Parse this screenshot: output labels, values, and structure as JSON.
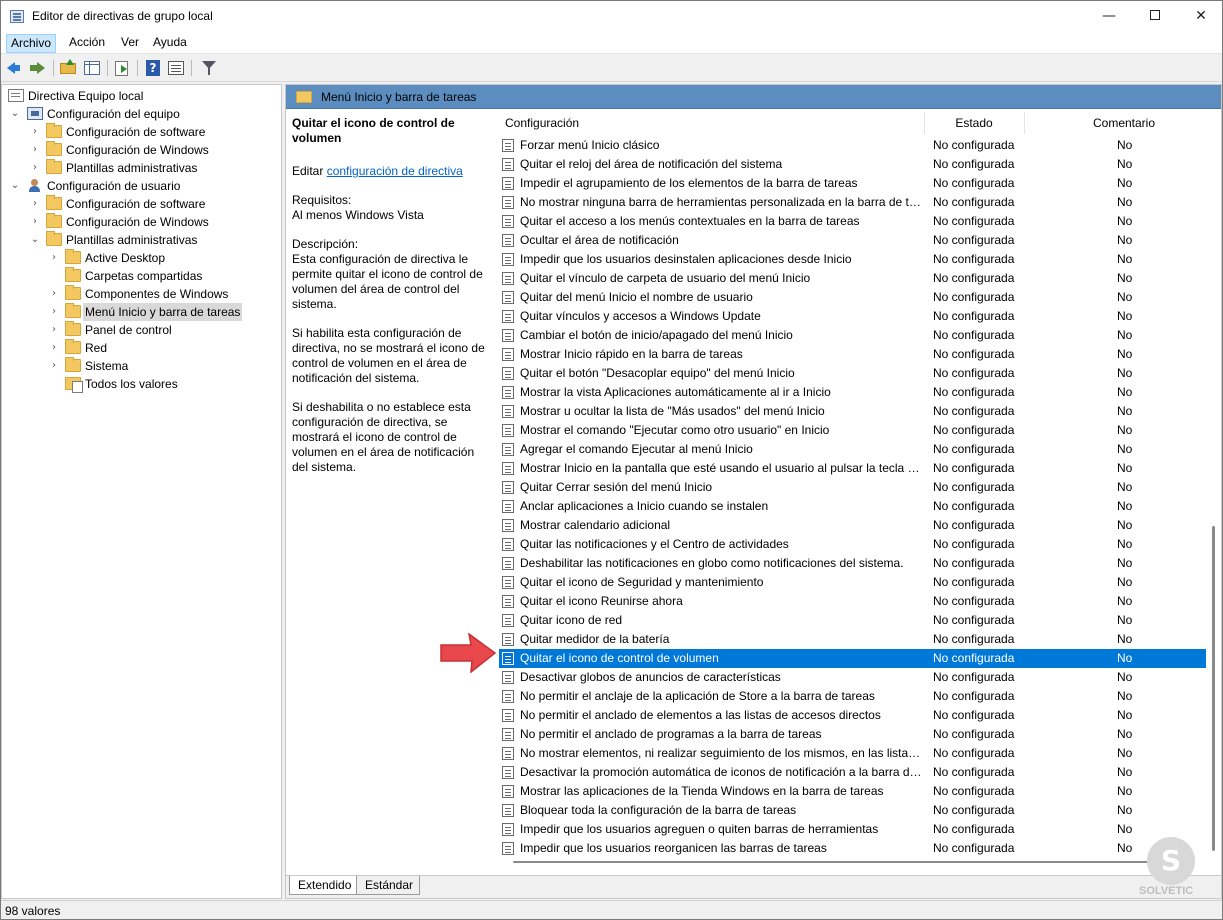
{
  "window": {
    "title": "Editor de directivas de grupo local",
    "minimize_glyph": "—",
    "close_glyph": "✕"
  },
  "menu": {
    "items": [
      "Archivo",
      "Acción",
      "Ver",
      "Ayuda"
    ]
  },
  "tree": {
    "root": "Directiva Equipo local",
    "items": [
      {
        "label": "Configuración del equipo"
      },
      {
        "label": "Configuración de software"
      },
      {
        "label": "Configuración de Windows"
      },
      {
        "label": "Plantillas administrativas"
      },
      {
        "label": "Configuración de usuario"
      },
      {
        "label": "Configuración de software"
      },
      {
        "label": "Configuración de Windows"
      },
      {
        "label": "Plantillas administrativas"
      },
      {
        "label": "Active Desktop"
      },
      {
        "label": "Carpetas compartidas"
      },
      {
        "label": "Componentes de Windows"
      },
      {
        "label": "Menú Inicio y barra de tareas"
      },
      {
        "label": "Panel de control"
      },
      {
        "label": "Red"
      },
      {
        "label": "Sistema"
      },
      {
        "label": "Todos los valores"
      }
    ]
  },
  "main": {
    "header_title": "Menú Inicio y barra de tareas",
    "description": {
      "title": "Quitar el icono de control de volumen",
      "edit_prefix": "Editar",
      "edit_link": "configuración de directiva",
      "requirements_label": "Requisitos:",
      "requirements_value": "Al menos Windows Vista",
      "description_label": "Descripción:",
      "description_text": "Esta configuración de directiva le permite quitar el icono de control de volumen del área de control del sistema.",
      "enabled_text": "Si habilita esta configuración de directiva, no se mostrará el icono de control de volumen en el área de notificación del sistema.",
      "disabled_text": "Si deshabilita o no establece esta configuración de directiva, se mostrará el icono de control de volumen en el área de notificación del sistema."
    },
    "columns": {
      "name": "Configuración",
      "state": "Estado",
      "comment": "Comentario"
    },
    "rows": [
      {
        "name": "Forzar menú Inicio clásico",
        "state": "No configurada",
        "comment": "No"
      },
      {
        "name": "Quitar el reloj del área de notificación del sistema",
        "state": "No configurada",
        "comment": "No"
      },
      {
        "name": "Impedir el agrupamiento de los elementos de la barra de tareas",
        "state": "No configurada",
        "comment": "No"
      },
      {
        "name": "No mostrar ninguna barra de herramientas personalizada en la barra de tar...",
        "state": "No configurada",
        "comment": "No"
      },
      {
        "name": "Quitar el acceso a los menús contextuales en la barra de tareas",
        "state": "No configurada",
        "comment": "No"
      },
      {
        "name": "Ocultar el área de notificación",
        "state": "No configurada",
        "comment": "No"
      },
      {
        "name": "Impedir que los usuarios desinstalen aplicaciones desde Inicio",
        "state": "No configurada",
        "comment": "No"
      },
      {
        "name": "Quitar el vínculo de carpeta de usuario del menú Inicio",
        "state": "No configurada",
        "comment": "No"
      },
      {
        "name": "Quitar del menú Inicio el nombre de usuario",
        "state": "No configurada",
        "comment": "No"
      },
      {
        "name": "Quitar vínculos y accesos a Windows Update",
        "state": "No configurada",
        "comment": "No"
      },
      {
        "name": "Cambiar el botón de inicio/apagado del menú Inicio",
        "state": "No configurada",
        "comment": "No"
      },
      {
        "name": "Mostrar Inicio rápido en la barra de tareas",
        "state": "No configurada",
        "comment": "No"
      },
      {
        "name": "Quitar el botón \"Desacoplar equipo\" del menú Inicio",
        "state": "No configurada",
        "comment": "No"
      },
      {
        "name": "Mostrar la vista Aplicaciones automáticamente al ir a Inicio",
        "state": "No configurada",
        "comment": "No"
      },
      {
        "name": "Mostrar u ocultar la lista de \"Más usados\" del menú Inicio",
        "state": "No configurada",
        "comment": "No"
      },
      {
        "name": "Mostrar el comando \"Ejecutar como otro usuario\" en Inicio",
        "state": "No configurada",
        "comment": "No"
      },
      {
        "name": "Agregar el comando Ejecutar al menú Inicio",
        "state": "No configurada",
        "comment": "No"
      },
      {
        "name": "Mostrar Inicio en la pantalla que esté usando el usuario al pulsar la tecla de...",
        "state": "No configurada",
        "comment": "No"
      },
      {
        "name": "Quitar Cerrar sesión del menú Inicio",
        "state": "No configurada",
        "comment": "No"
      },
      {
        "name": "Anclar aplicaciones a Inicio cuando se instalen",
        "state": "No configurada",
        "comment": "No"
      },
      {
        "name": "Mostrar calendario adicional",
        "state": "No configurada",
        "comment": "No"
      },
      {
        "name": "Quitar las notificaciones y el Centro de actividades",
        "state": "No configurada",
        "comment": "No"
      },
      {
        "name": "Deshabilitar las notificaciones en globo como notificaciones del sistema.",
        "state": "No configurada",
        "comment": "No"
      },
      {
        "name": "Quitar el icono de Seguridad y mantenimiento",
        "state": "No configurada",
        "comment": "No"
      },
      {
        "name": "Quitar el icono Reunirse ahora",
        "state": "No configurada",
        "comment": "No"
      },
      {
        "name": "Quitar icono de red",
        "state": "No configurada",
        "comment": "No"
      },
      {
        "name": "Quitar medidor de la batería",
        "state": "No configurada",
        "comment": "No"
      },
      {
        "name": "Quitar el icono de control de volumen",
        "state": "No configurada",
        "comment": "No",
        "selected": true
      },
      {
        "name": "Desactivar globos de anuncios de características",
        "state": "No configurada",
        "comment": "No"
      },
      {
        "name": "No permitir el anclaje de la aplicación de Store a la barra de tareas",
        "state": "No configurada",
        "comment": "No"
      },
      {
        "name": "No permitir el anclado de elementos a las listas de accesos directos",
        "state": "No configurada",
        "comment": "No"
      },
      {
        "name": "No permitir el anclado de programas a la barra de tareas",
        "state": "No configurada",
        "comment": "No"
      },
      {
        "name": "No mostrar elementos, ni realizar seguimiento de los mismos, en las listas ...",
        "state": "No configurada",
        "comment": "No"
      },
      {
        "name": "Desactivar la promoción automática de iconos de notificación a la barra de...",
        "state": "No configurada",
        "comment": "No"
      },
      {
        "name": "Mostrar las aplicaciones de la Tienda Windows en la barra de tareas",
        "state": "No configurada",
        "comment": "No"
      },
      {
        "name": "Bloquear toda la configuración de la barra de tareas",
        "state": "No configurada",
        "comment": "No"
      },
      {
        "name": "Impedir que los usuarios agreguen o quiten barras de herramientas",
        "state": "No configurada",
        "comment": "No"
      },
      {
        "name": "Impedir que los usuarios reorganicen las barras de tareas",
        "state": "No configurada",
        "comment": "No"
      }
    ],
    "tabs": [
      "Extendido",
      "Estándar"
    ]
  },
  "status": {
    "text": "98 valores"
  },
  "watermark": {
    "text": "SOLVETIC"
  },
  "colors": {
    "selection": "#0078d7",
    "header_band": "#5c8dc0",
    "pointer_arrow": "#e8474c"
  }
}
